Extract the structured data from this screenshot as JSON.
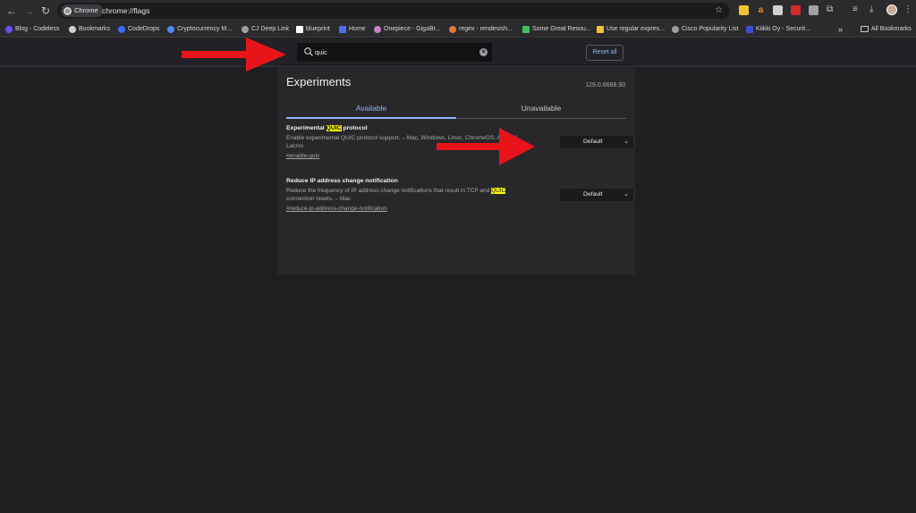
{
  "browser": {
    "chip_label": "Chrome",
    "url": "chrome://flags",
    "icons": [
      "back-icon",
      "forward-icon",
      "reload-icon",
      "bookmark-star-icon",
      "extensions-icon",
      "download-icon",
      "profile-avatar"
    ]
  },
  "bookmarks": {
    "items": [
      {
        "label": "Blog - Codeless",
        "color": "#6f4ef2"
      },
      {
        "label": "Bookmarks",
        "color": "#cfcfcf"
      },
      {
        "label": "CodeDrops",
        "color": "#3b6df0"
      },
      {
        "label": "Cryptocurrency M...",
        "color": "#4a8cf0"
      },
      {
        "label": "CJ Deep Link",
        "color": "#9e9e9e"
      },
      {
        "label": "blueprint",
        "color": "#ffffff"
      },
      {
        "label": "Home",
        "color": "#4a6ff0"
      },
      {
        "label": "Onepiece - GigaBr...",
        "color": "#c97fc9"
      },
      {
        "label": "regex - rendesish...",
        "color": "#e07a3a"
      },
      {
        "label": "Some Great Resou...",
        "color": "#3cc25c"
      },
      {
        "label": "Use regular expres...",
        "color": "#f2c230"
      },
      {
        "label": "Cisco Popularity List",
        "color": "#9e9e9e"
      },
      {
        "label": "Kiikki Oy - Securit...",
        "color": "#3a4fd0"
      }
    ],
    "more": "»",
    "all_bookmarks": "All Bookmarks"
  },
  "flags": {
    "search_value": "quic",
    "reset_label": "Reset all",
    "title": "Experiments",
    "version": "129.0.6668.90",
    "tabs": {
      "available": "Available",
      "unavailable": "Unavailable"
    },
    "items": [
      {
        "title_pre": "Experimental ",
        "title_hl": "QUIC",
        "title_post": " protocol",
        "desc": "Enable experimental QUIC protocol support. – Mac, Windows, Linux, ChromeOS, Android, Lacros",
        "link": "#enable-quic",
        "value": "Default"
      },
      {
        "title": "Reduce IP address change notification",
        "desc_pre": "Reduce the frequency of IP address change notifications that result in TCP and ",
        "desc_hl": "QUIC",
        "desc_post": " connection resets. – Mac",
        "link": "#reduce-ip-address-change-notification",
        "value": "Default"
      }
    ]
  },
  "annotation_color": "#e8141a"
}
